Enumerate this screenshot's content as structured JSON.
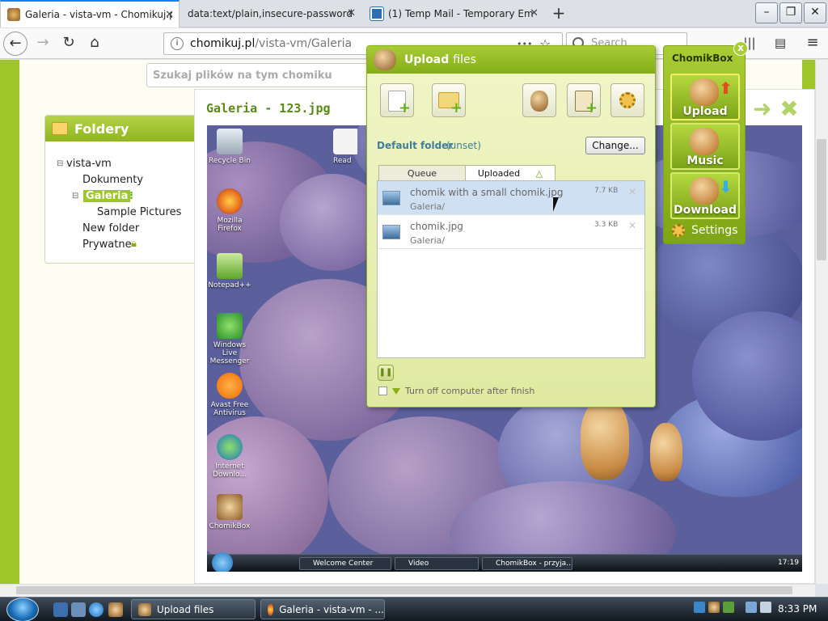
{
  "browser": {
    "tabs": [
      {
        "label": "Galeria - vista-vm - Chomikuj.p",
        "active": true
      },
      {
        "label": "data:text/plain,insecure-password",
        "active": false
      },
      {
        "label": "(1) Temp Mail - Temporary Em",
        "active": false
      }
    ],
    "new_tab": "+",
    "url_host": "chomikuj.pl",
    "url_path": "/vista-vm/Galeria",
    "url_menu": "•••",
    "search_placeholder": "Search"
  },
  "page": {
    "search_placeholder": "Szukaj plików na tym chomiku",
    "folders_title": "Foldery",
    "tree": {
      "root": "vista-vm",
      "items": [
        "Dokumenty",
        "Galeria",
        "Sample Pictures",
        "New folder",
        "Prywatne"
      ]
    },
    "gallery_title": "Galeria - 123.jpg",
    "gallery_next": "➜ ✖"
  },
  "desktop": {
    "icons": [
      "Recycle Bin",
      "Mozilla Firefox",
      "Notepad++",
      "Windows Live Messenger",
      "Avast Free Antivirus",
      "Internet Downlo...",
      "ChomikBox"
    ],
    "readme_label": "Read",
    "taskbar_buttons": [
      "Welcome Center",
      "Video",
      "ChomikBox - przyja..."
    ],
    "clock": "17:19"
  },
  "upload_dialog": {
    "title_bold": "Upload",
    "title_rest": "files",
    "default_folder_label": "Default folder",
    "default_folder_value": "(unset)",
    "change_button": "Change...",
    "tabs": [
      "Queue",
      "Uploaded"
    ],
    "files": [
      {
        "name": "chomik with a small chomik.jpg",
        "folder": "Galeria/",
        "size": "7.7 KB"
      },
      {
        "name": "chomik.jpg",
        "folder": "Galeria/",
        "size": "3.3 KB"
      }
    ],
    "turn_off_label": "Turn off computer after finish"
  },
  "chomikbox": {
    "title": "ChomikBox",
    "close": "x",
    "buttons": [
      "Upload",
      "Music",
      "Download"
    ],
    "settings": "Settings"
  },
  "taskbar": {
    "buttons": [
      "Upload files",
      "Galeria - vista-vm - ..."
    ],
    "clock": "8:33 PM"
  }
}
